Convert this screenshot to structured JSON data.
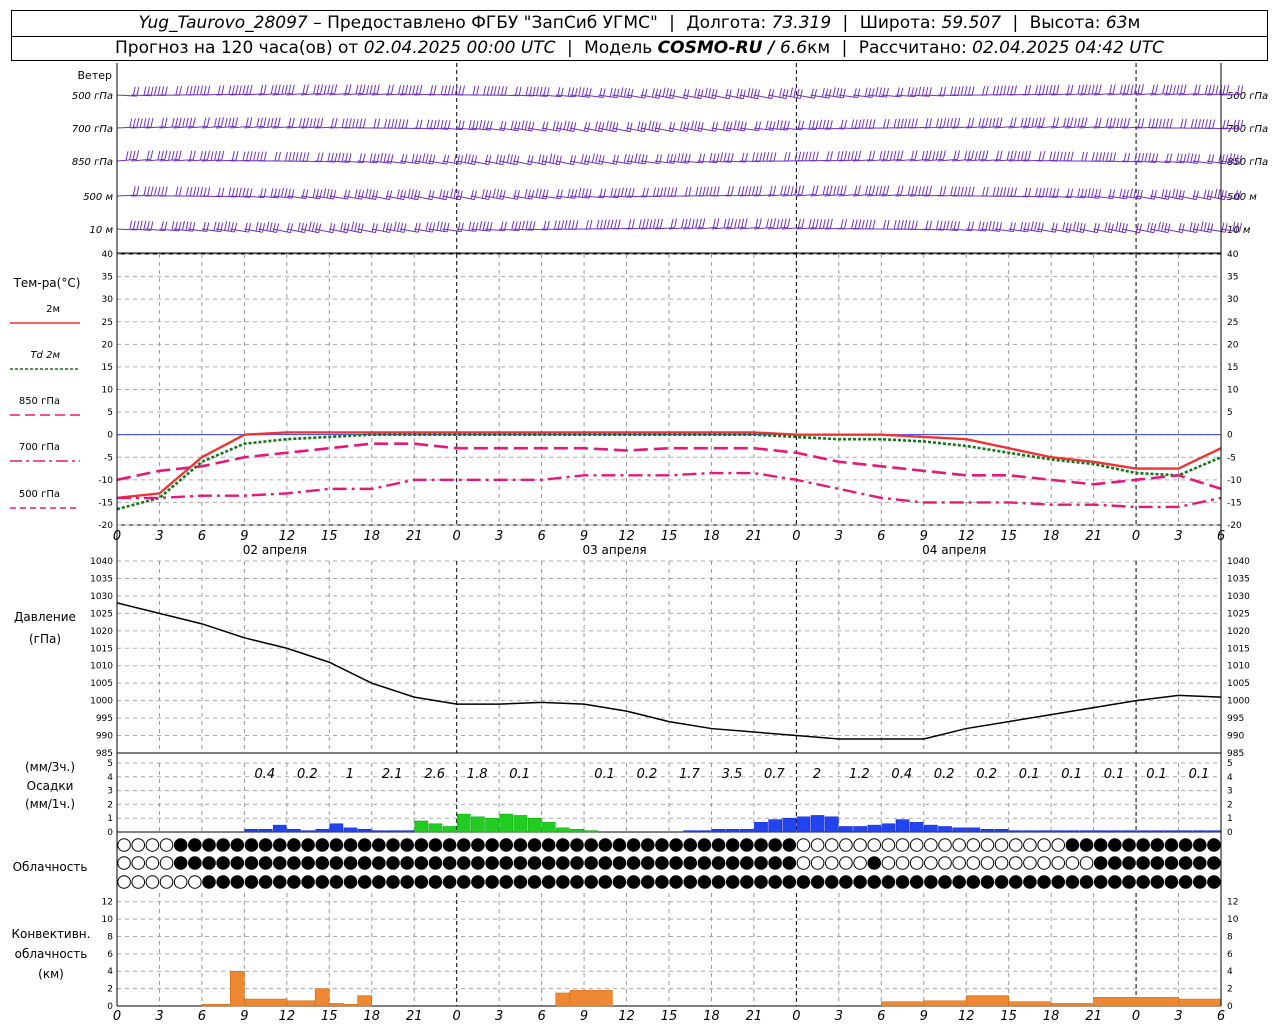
{
  "header": {
    "station": "Yug_Taurovo_28097",
    "provider": "– Предоставлено ФГБУ \"ЗапСиб УГМС\"",
    "lon_label": "Долгота:",
    "lon_value": "73.319",
    "lat_label": "Широта:",
    "lat_value": "59.507",
    "alt_label": "Высота:",
    "alt_value": "63",
    "alt_unit": "м",
    "forecast_label": "Прогноз на 120 часа(ов) от",
    "forecast_start": "02.04.2025 00:00 UTC",
    "model_label": "Модель",
    "model_name": "COSMO-RU /",
    "model_res": "6.6",
    "model_res_unit": "км",
    "calc_label": "Рассчитано:",
    "calc_time": "02.04.2025 04:42 UTC"
  },
  "colors": {
    "wind": "#7030c0",
    "t2m": "#ee3333",
    "td2m": "#11771a",
    "t850": "#e8187a",
    "t700": "#e8187a",
    "t500": "#e8187a",
    "pressure": "#000000",
    "precip_rain": "#22cc22",
    "precip_snow": "#2244ee",
    "conv": "#ee8833",
    "zero_line": "#3344ee"
  },
  "chart_data": [
    {
      "type": "wind-barbs",
      "title": "Ветер",
      "levels": [
        "500 гПа",
        "700 гПа",
        "850 гПа",
        "500 м",
        "10 м"
      ]
    },
    {
      "type": "line",
      "title": "Тем-ра(°C)",
      "x_ticks": [
        "0",
        "3",
        "6",
        "9",
        "12",
        "15",
        "18",
        "21",
        "0",
        "3",
        "6",
        "9",
        "12",
        "15",
        "18",
        "21",
        "0",
        "3",
        "6",
        "9",
        "12",
        "15",
        "18",
        "21",
        "0",
        "3",
        "6"
      ],
      "day_labels": [
        "02 апреля",
        "03 апреля",
        "04 апреля"
      ],
      "ylim": [
        -20,
        40
      ],
      "y_ticks": [
        -20,
        -15,
        -10,
        -5,
        0,
        5,
        10,
        15,
        20,
        25,
        30,
        35,
        40
      ],
      "x_hours": [
        0,
        3,
        6,
        9,
        12,
        15,
        18,
        21,
        24,
        27,
        30,
        33,
        36,
        39,
        42,
        45,
        48,
        51,
        54,
        57,
        60,
        63,
        66,
        69,
        72,
        75,
        78
      ],
      "series": [
        {
          "name": "2м",
          "style": "solid",
          "values": [
            -14,
            -13,
            -5,
            0,
            0.5,
            0.5,
            0.5,
            0.5,
            0.5,
            0.5,
            0.5,
            0.5,
            0.5,
            0.5,
            0.5,
            0.5,
            0,
            0,
            0,
            -0.5,
            -1,
            -3,
            -5,
            -6,
            -7.5,
            -7.5,
            -3
          ]
        },
        {
          "name": "Td 2м",
          "style": "dotted",
          "values": [
            -16.5,
            -14,
            -6,
            -2,
            -1,
            -0.5,
            0,
            0,
            0,
            0,
            0,
            0,
            0,
            0,
            0,
            0,
            -0.5,
            -1,
            -1,
            -1.5,
            -2.5,
            -4,
            -5.5,
            -6.5,
            -8.5,
            -9,
            -5
          ]
        },
        {
          "name": "850 гПа",
          "style": "dashed",
          "values": [
            -10,
            -8,
            -7,
            -5,
            -4,
            -3,
            -2,
            -2,
            -3,
            -3,
            -3,
            -3,
            -3.5,
            -3,
            -3,
            -3,
            -4,
            -6,
            -7,
            -8,
            -9,
            -9,
            -10,
            -11,
            -10,
            -9,
            -12
          ]
        },
        {
          "name": "700 гПа",
          "style": "dashdot",
          "values": [
            -14,
            -14,
            -13.5,
            -13.5,
            -13,
            -12,
            -12,
            -10,
            -10,
            -10,
            -10,
            -9,
            -9,
            -9,
            -8.5,
            -8.5,
            -10,
            -12,
            -14,
            -15,
            -15,
            -15,
            -15.5,
            -15.5,
            -16,
            -16,
            -14
          ]
        },
        {
          "name": "500 гПа",
          "style": "dashed-thin",
          "values": []
        }
      ]
    },
    {
      "type": "line",
      "title": "Давление",
      "ylabel": "(гПа)",
      "ylim": [
        985,
        1040
      ],
      "y_ticks": [
        985,
        990,
        995,
        1000,
        1005,
        1010,
        1015,
        1020,
        1025,
        1030,
        1035,
        1040
      ],
      "x_hours": [
        0,
        3,
        6,
        9,
        12,
        15,
        18,
        21,
        24,
        27,
        30,
        33,
        36,
        39,
        42,
        45,
        48,
        51,
        54,
        57,
        60,
        63,
        66,
        69,
        72,
        75,
        78
      ],
      "values": [
        1028,
        1025,
        1022,
        1018,
        1015,
        1011,
        1005,
        1001,
        999,
        999,
        999.5,
        999,
        997,
        994,
        992,
        991,
        990,
        989,
        989,
        989,
        992,
        994,
        996,
        998,
        1000,
        1001.5,
        1001
      ]
    },
    {
      "type": "bar",
      "title": "Осадки",
      "ylabel_top": "(мм/3ч.)",
      "ylabel_bottom": "(мм/1ч.)",
      "ylim": [
        0,
        5
      ],
      "y_ticks": [
        0,
        1,
        2,
        3,
        4,
        5
      ],
      "totals_3h": [
        {
          "hour": 12,
          "value": "0.4"
        },
        {
          "hour": 15,
          "value": "0.2"
        },
        {
          "hour": 18,
          "value": "1"
        },
        {
          "hour": 21,
          "value": "2.1"
        },
        {
          "hour": 24,
          "value": "2.6"
        },
        {
          "hour": 27,
          "value": "1.8"
        },
        {
          "hour": 30,
          "value": "0.1"
        },
        {
          "hour": 36,
          "value": "0.1"
        },
        {
          "hour": 39,
          "value": "0.2"
        },
        {
          "hour": 42,
          "value": "1.7"
        },
        {
          "hour": 45,
          "value": "3.5"
        },
        {
          "hour": 48,
          "value": "0.7"
        },
        {
          "hour": 51,
          "value": "2"
        },
        {
          "hour": 54,
          "value": "1.2"
        },
        {
          "hour": 57,
          "value": "0.4"
        },
        {
          "hour": 60,
          "value": "0.2"
        },
        {
          "hour": 63,
          "value": "0.2"
        },
        {
          "hour": 66,
          "value": "0.1"
        },
        {
          "hour": 69,
          "value": "0.1"
        },
        {
          "hour": 72,
          "value": "0.1"
        },
        {
          "hour": 75,
          "value": "0.1"
        },
        {
          "hour": 78,
          "value": "0.1"
        }
      ],
      "hourly_rain": [
        0,
        0,
        0,
        0,
        0,
        0,
        0,
        0,
        0,
        0,
        0,
        0,
        0,
        0,
        0,
        0,
        0,
        0,
        0,
        0,
        0,
        0.8,
        0.6,
        0.4,
        1.3,
        1.1,
        1.0,
        1.3,
        1.2,
        1.0,
        0.7,
        0.3,
        0.2,
        0.1,
        0,
        0,
        0,
        0,
        0,
        0,
        0,
        0,
        0,
        0,
        0,
        0,
        0,
        0,
        0,
        0,
        0,
        0,
        0,
        0,
        0,
        0,
        0,
        0,
        0,
        0,
        0,
        0,
        0,
        0,
        0,
        0,
        0,
        0,
        0,
        0,
        0,
        0,
        0,
        0,
        0,
        0,
        0,
        0,
        0
      ],
      "hourly_snow": [
        0,
        0,
        0,
        0,
        0,
        0,
        0,
        0,
        0,
        0.2,
        0.2,
        0.5,
        0.2,
        0.1,
        0.2,
        0.6,
        0.3,
        0.2,
        0.1,
        0.1,
        0.1,
        0,
        0,
        0,
        0,
        0,
        0,
        0,
        0,
        0,
        0,
        0,
        0,
        0,
        0,
        0,
        0,
        0,
        0,
        0,
        0.1,
        0.1,
        0.2,
        0.2,
        0.2,
        0.7,
        0.9,
        1.0,
        1.1,
        1.2,
        1.1,
        0.4,
        0.4,
        0.5,
        0.6,
        0.9,
        0.7,
        0.5,
        0.4,
        0.3,
        0.3,
        0.2,
        0.2,
        0.1,
        0.1,
        0.1,
        0.1,
        0.1,
        0.1,
        0.1,
        0.1,
        0.1,
        0.1,
        0.1,
        0.1,
        0.1,
        0.1,
        0.1,
        0.1,
        0.1,
        0.1,
        0.1,
        0.1,
        0.1,
        0.1,
        0.1,
        0.1,
        0.1,
        0.1,
        0.1,
        0.1,
        0.1,
        0.1,
        0.1,
        0.1,
        0.1,
        0.1,
        0.1,
        0.1,
        0.1,
        0.1,
        0.1,
        0.1,
        0.1,
        0.1,
        0.1,
        0.1,
        0.1,
        0.1,
        0.1,
        0.1,
        0.1,
        0.1,
        0.1,
        0.1,
        0.2,
        0.2,
        0.2,
        0.1,
        0.1
      ]
    },
    {
      "type": "table",
      "title": "Облачность",
      "rows": 3,
      "symbol": "cloud-cover-circle"
    },
    {
      "type": "bar",
      "title": "Конвективн. облачность (км)",
      "ylim": [
        0,
        13
      ],
      "y_ticks": [
        0,
        2,
        4,
        6,
        8,
        10,
        12
      ],
      "bars": [
        {
          "from": 6,
          "to": 9,
          "value": 0.2
        },
        {
          "from": 8,
          "to": 9,
          "value": 4.0
        },
        {
          "from": 9,
          "to": 12,
          "value": 0.8
        },
        {
          "from": 12,
          "to": 14,
          "value": 0.6
        },
        {
          "from": 14,
          "to": 15,
          "value": 2.0
        },
        {
          "from": 15,
          "to": 16,
          "value": 0.3
        },
        {
          "from": 16,
          "to": 17,
          "value": 0.2
        },
        {
          "from": 17,
          "to": 18,
          "value": 1.2
        },
        {
          "from": 31,
          "to": 32,
          "value": 1.5
        },
        {
          "from": 32,
          "to": 35,
          "value": 1.8
        },
        {
          "from": 54,
          "to": 57,
          "value": 0.5
        },
        {
          "from": 57,
          "to": 60,
          "value": 0.6
        },
        {
          "from": 60,
          "to": 63,
          "value": 1.2
        },
        {
          "from": 63,
          "to": 66,
          "value": 0.5
        },
        {
          "from": 66,
          "to": 69,
          "value": 0.3
        },
        {
          "from": 69,
          "to": 75,
          "value": 1.0
        },
        {
          "from": 75,
          "to": 78,
          "value": 0.8
        }
      ]
    }
  ]
}
